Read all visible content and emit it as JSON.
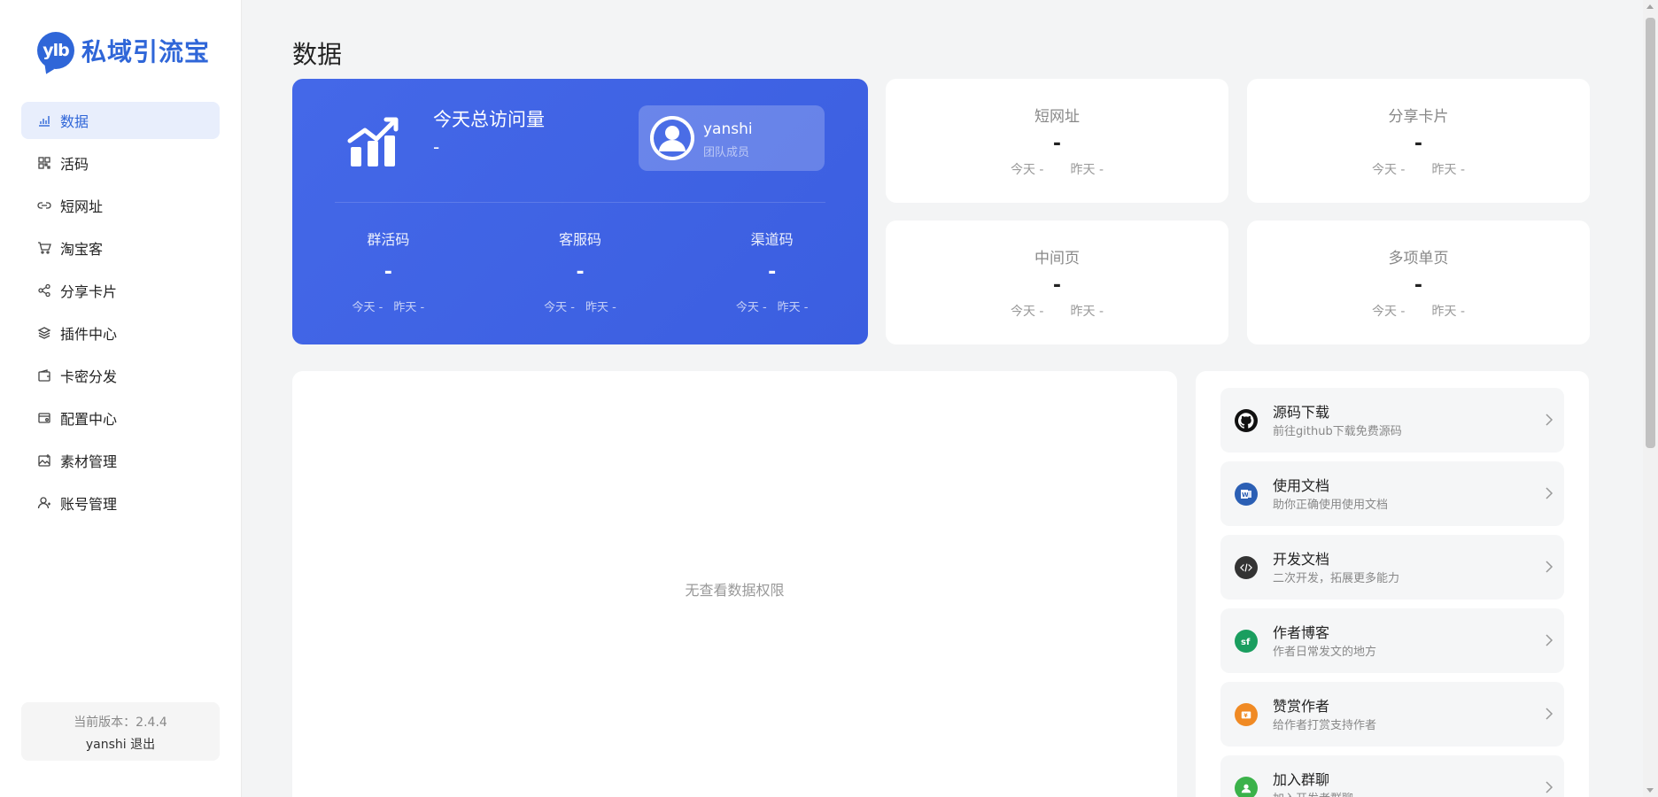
{
  "app": {
    "logo_badge": "ylb",
    "logo_text": "私域引流宝"
  },
  "sidebar": {
    "items": [
      {
        "label": "数据",
        "icon": "chart-icon",
        "active": true
      },
      {
        "label": "活码",
        "icon": "grid-icon",
        "active": false
      },
      {
        "label": "短网址",
        "icon": "link-icon",
        "active": false
      },
      {
        "label": "淘宝客",
        "icon": "cart-icon",
        "active": false
      },
      {
        "label": "分享卡片",
        "icon": "share-icon",
        "active": false
      },
      {
        "label": "插件中心",
        "icon": "layers-icon",
        "active": false
      },
      {
        "label": "卡密分发",
        "icon": "wallet-icon",
        "active": false
      },
      {
        "label": "配置中心",
        "icon": "config-icon",
        "active": false
      },
      {
        "label": "素材管理",
        "icon": "image-icon",
        "active": false
      },
      {
        "label": "账号管理",
        "icon": "user-icon",
        "active": false
      }
    ],
    "version_label": "当前版本：2.4.4",
    "username": "yanshi",
    "logout_label": "退出"
  },
  "main": {
    "page_title": "数据",
    "hero": {
      "title": "今天总访问量",
      "value": "-",
      "user_name": "yanshi",
      "user_role": "团队成员",
      "stats": [
        {
          "label": "群活码",
          "value": "-",
          "today": "今天 -",
          "yesterday": "昨天 -"
        },
        {
          "label": "客服码",
          "value": "-",
          "today": "今天 -",
          "yesterday": "昨天 -"
        },
        {
          "label": "渠道码",
          "value": "-",
          "today": "今天 -",
          "yesterday": "昨天 -"
        }
      ]
    },
    "cards": [
      {
        "label": "短网址",
        "value": "-",
        "today": "今天 -",
        "yesterday": "昨天 -"
      },
      {
        "label": "分享卡片",
        "value": "-",
        "today": "今天 -",
        "yesterday": "昨天 -"
      },
      {
        "label": "中间页",
        "value": "-",
        "today": "今天 -",
        "yesterday": "昨天 -"
      },
      {
        "label": "多项单页",
        "value": "-",
        "today": "今天 -",
        "yesterday": "昨天 -"
      }
    ],
    "empty_text": "无查看数据权限",
    "links": [
      {
        "title": "源码下载",
        "desc": "前往github下载免费源码",
        "icon": "github-icon",
        "color": "#111111"
      },
      {
        "title": "使用文档",
        "desc": "助你正确使用使用文档",
        "icon": "word-doc-icon",
        "color": "#2b5fb4"
      },
      {
        "title": "开发文档",
        "desc": "二次开发，拓展更多能力",
        "icon": "code-icon",
        "color": "#333333"
      },
      {
        "title": "作者博客",
        "desc": "作者日常发文的地方",
        "icon": "segmentfault-icon",
        "color": "#1a9e5f"
      },
      {
        "title": "赞赏作者",
        "desc": "给作者打赏支持作者",
        "icon": "reward-icon",
        "color": "#f08a24"
      },
      {
        "title": "加入群聊",
        "desc": "加入开发者群聊",
        "icon": "group-chat-icon",
        "color": "#3bb24a"
      }
    ]
  }
}
